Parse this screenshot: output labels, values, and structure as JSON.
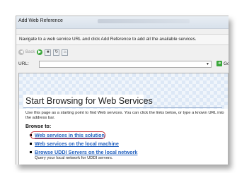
{
  "window": {
    "title": "Add Web Reference"
  },
  "instruction": "Navigate to a web service URL and click Add Reference to add all the available services.",
  "toolbar": {
    "back_label": "Back",
    "back_icon": "back-arrow-icon",
    "forward_icon": "forward-arrow-icon",
    "stop_icon": "stop-icon",
    "refresh_icon": "refresh-icon",
    "home_icon": "home-icon"
  },
  "url_bar": {
    "label": "URL:",
    "value": "",
    "go_label": "Go"
  },
  "browser": {
    "heading": "Start Browsing for Web Services",
    "intro": "Use this page as a starting point to find Web services. You can click the links below, or type a known URL into the address bar.",
    "browse_to_label": "Browse to:",
    "links": [
      {
        "label": "Web services in this solution",
        "subtext": ""
      },
      {
        "label": "Web services on the local machine",
        "subtext": ""
      },
      {
        "label": "Browse UDDI Servers on the local network",
        "subtext": "Query your local network for UDDI servers."
      }
    ]
  },
  "colors": {
    "link": "#1f5fbf",
    "highlight": "#c4303a",
    "go_green": "#3aa63a"
  }
}
